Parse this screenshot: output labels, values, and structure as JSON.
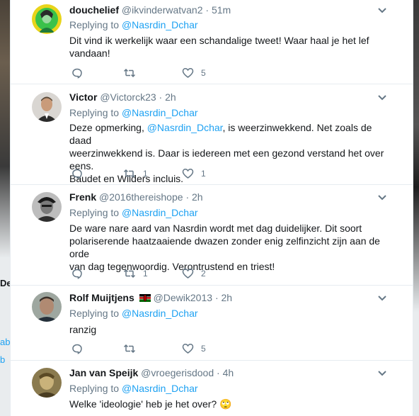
{
  "tweets": [
    {
      "name": "douchelief",
      "handle": "@ikvinderwatvan2",
      "dot": "·",
      "time": "51m",
      "replying_prefix": "Replying to",
      "replying_to": "@Nasrdin_Dchar",
      "text_lines": [
        "Dit vind ik werkelijk waar een schandalige tweet! Waar haal je het lef",
        "vandaan!"
      ],
      "reply_count": "",
      "retweet_count": "",
      "like_count": "5"
    },
    {
      "name": "Victor",
      "handle": "@Victorck23",
      "dot": "·",
      "time": "2h",
      "replying_prefix": "Replying to",
      "replying_to": "@Nasrdin_Dchar",
      "text_start": "Deze opmerking, ",
      "text_mention": "@Nasrdin_Dchar",
      "text_after": ", is weerzinwekkend. Net zoals de daad",
      "text_lines_rest": [
        "weerzinwekkend is. Daar is iedereen met een gezond verstand het over eens.",
        "Baudet en Wilders incluis."
      ],
      "reply_count": "",
      "retweet_count": "1",
      "like_count": "1"
    },
    {
      "name": "Frenk",
      "handle": "@2016thereishope",
      "dot": "·",
      "time": "2h",
      "replying_prefix": "Replying to",
      "replying_to": "@Nasrdin_Dchar",
      "text_lines": [
        "De ware nare aard van Nasrdin wordt met dag duidelijker. Dit soort",
        "polariserende haatzaaiende dwazen zonder enig zelfinzicht zijn aan de orde",
        "van dag tegenwoordig. Verontrustend en triest!"
      ],
      "reply_count": "",
      "retweet_count": "1",
      "like_count": "2"
    },
    {
      "name": "Rolf Muijtjens",
      "handle": "@Dewik2013",
      "dot": "·",
      "time": "2h",
      "replying_prefix": "Replying to",
      "replying_to": "@Nasrdin_Dchar",
      "text_lines": [
        "ranzig"
      ],
      "reply_count": "",
      "retweet_count": "",
      "like_count": "5"
    },
    {
      "name": "Jan van Speijk",
      "handle": "@vroegerisdood",
      "dot": "·",
      "time": "4h",
      "replying_prefix": "Replying to",
      "replying_to": "@Nasrdin_Dchar",
      "text_lines": [
        "Welke 'ideologie' heb je het over? 🙄"
      ]
    }
  ],
  "background": {
    "left_fragments": [
      "De",
      "ab",
      "b"
    ]
  },
  "colors": {
    "link": "#1da1f2",
    "secondary": "#657786",
    "text": "#14171a",
    "divider": "#e6ecf0"
  }
}
